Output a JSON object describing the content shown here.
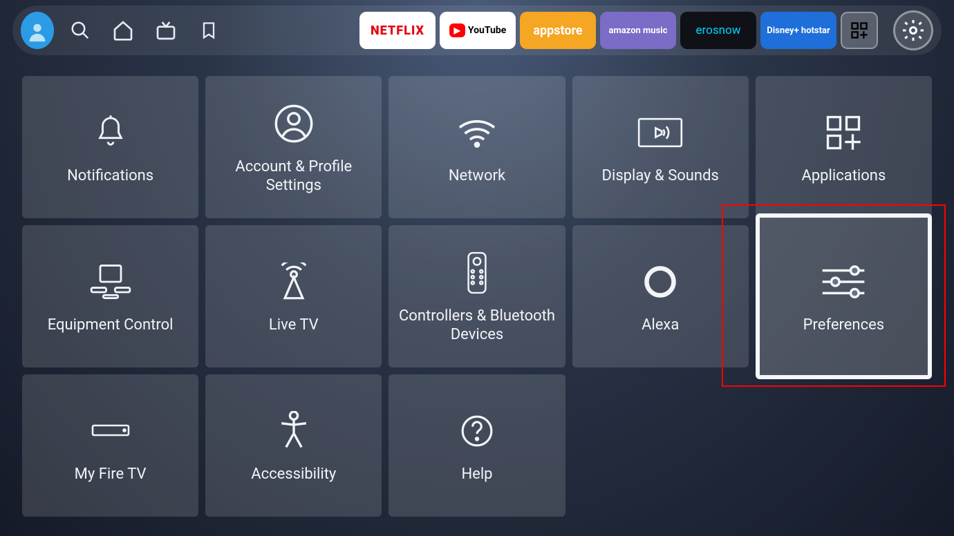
{
  "apps": {
    "netflix": "NETFLIX",
    "youtube": "YouTube",
    "appstore": "appstore",
    "amazonmusic": "amazon music",
    "erosnow": "erosnow",
    "hotstar": "Disney+ hotstar"
  },
  "tiles": [
    {
      "label": "Notifications"
    },
    {
      "label": "Account & Profile Settings"
    },
    {
      "label": "Network"
    },
    {
      "label": "Display & Sounds"
    },
    {
      "label": "Applications"
    },
    {
      "label": "Equipment Control"
    },
    {
      "label": "Live TV"
    },
    {
      "label": "Controllers & Bluetooth Devices"
    },
    {
      "label": "Alexa"
    },
    {
      "label": "Preferences"
    },
    {
      "label": "My Fire TV"
    },
    {
      "label": "Accessibility"
    },
    {
      "label": "Help"
    }
  ]
}
